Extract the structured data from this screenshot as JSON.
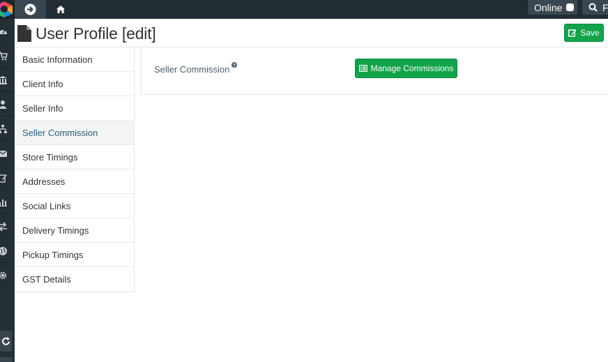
{
  "topbar": {
    "online_label": "Online",
    "search_label": "F",
    "back_icon": "arrow-circle-right-icon",
    "home_icon": "home-icon"
  },
  "rail": {
    "icons": [
      "dashboard-icon",
      "shopping-cart-icon",
      "bank-icon",
      "users-icon",
      "sitemap-icon",
      "envelope-icon",
      "edit-icon",
      "bar-chart-icon",
      "exchange-icon",
      "globe-icon",
      "gear-icon"
    ],
    "refresh_icon": "refresh-icon"
  },
  "page": {
    "title": "User Profile [edit]",
    "save_label": "Save"
  },
  "sidenav": {
    "items": [
      {
        "label": "Basic Information",
        "active": false
      },
      {
        "label": "Client Info",
        "active": false
      },
      {
        "label": "Seller Info",
        "active": false
      },
      {
        "label": "Seller Commission",
        "active": true
      },
      {
        "label": "Store Timings",
        "active": false
      },
      {
        "label": "Addresses",
        "active": false
      },
      {
        "label": "Social Links",
        "active": false
      },
      {
        "label": "Delivery Timings",
        "active": false
      },
      {
        "label": "Pickup Timings",
        "active": false
      },
      {
        "label": "GST Details",
        "active": false
      }
    ]
  },
  "panel": {
    "field_label": "Seller Commission",
    "help_mark": "?",
    "manage_label": "Manage Commissions"
  },
  "colors": {
    "accent_green": "#12a34b",
    "topbar": "#222c33",
    "rail": "#252f36",
    "active_nav_text": "#2e5e79"
  }
}
